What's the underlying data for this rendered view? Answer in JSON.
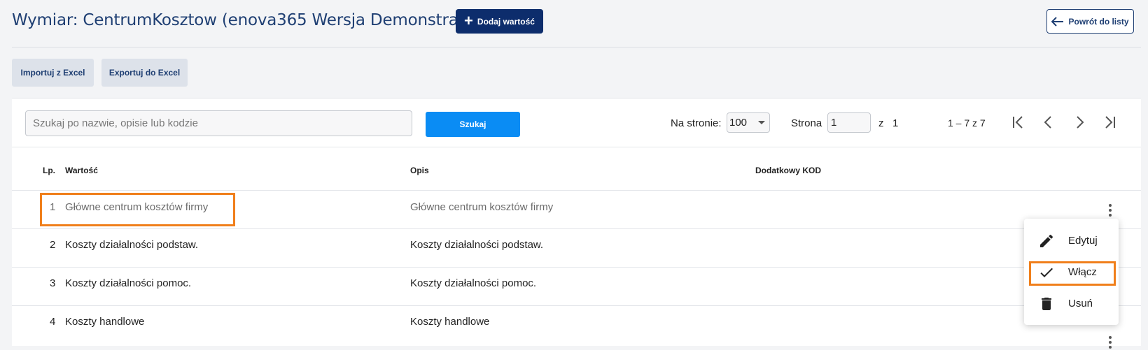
{
  "header": {
    "title": "Wymiar: CentrumKosztow (enova365 Wersja Demonstracyjna)",
    "add_button": "Dodaj wartość",
    "back_button": "Powrót do listy"
  },
  "actions": {
    "import": "Importuj z Excel",
    "export": "Exportuj do Excel"
  },
  "toolbar": {
    "search_placeholder": "Szukaj po nazwie, opisie lub kodzie",
    "search_button": "Szukaj",
    "per_page_label": "Na stronie:",
    "per_page_value": "100",
    "page_label": "Strona",
    "page_value": "1",
    "of_label": "z",
    "total_pages": "1",
    "range": "1 – 7 z 7"
  },
  "table": {
    "headers": {
      "lp": "Lp.",
      "value": "Wartość",
      "description": "Opis",
      "code": "Dodatkowy KOD"
    },
    "rows": [
      {
        "lp": "1",
        "value": "Główne centrum kosztów firmy",
        "description": "Główne centrum kosztów firmy",
        "code": "",
        "inactive": true
      },
      {
        "lp": "2",
        "value": "Koszty działalności podstaw.",
        "description": "Koszty działalności podstaw.",
        "code": ""
      },
      {
        "lp": "3",
        "value": "Koszty działalności pomoc.",
        "description": "Koszty działalności pomoc.",
        "code": ""
      },
      {
        "lp": "4",
        "value": "Koszty handlowe",
        "description": "Koszty handlowe",
        "code": ""
      }
    ]
  },
  "context_menu": {
    "edit": "Edytuj",
    "enable": "Włącz",
    "delete": "Usuń"
  },
  "colors": {
    "primary": "#0d2d6c",
    "search_button": "#0a8cf4",
    "highlight": "#f07f1b",
    "title": "#1f3f73"
  }
}
